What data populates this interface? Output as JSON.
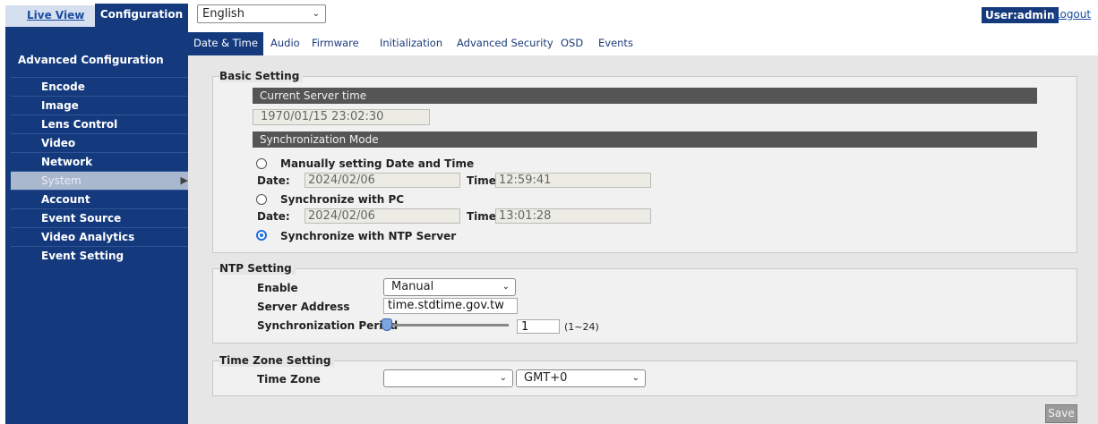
{
  "topbar": {
    "live_view": "Live View",
    "configuration": "Configuration",
    "language": "English",
    "user": "User:admin",
    "separator": "|",
    "logout": "Logout"
  },
  "sidebar": {
    "title": "Advanced Configuration",
    "items": [
      {
        "label": "Encode"
      },
      {
        "label": "Image"
      },
      {
        "label": "Lens Control"
      },
      {
        "label": "Video"
      },
      {
        "label": "Network"
      },
      {
        "label": "System"
      },
      {
        "label": "Account"
      },
      {
        "label": "Event Source"
      },
      {
        "label": "Video Analytics"
      },
      {
        "label": "Event Setting"
      }
    ],
    "active_item": "System"
  },
  "tabs": [
    "Date & Time",
    "Audio",
    "Firmware",
    "Initialization",
    "Advanced Security",
    "OSD",
    "Events"
  ],
  "active_tab": "Date & Time",
  "basic": {
    "legend": "Basic Setting",
    "current_server_time_header": "Current Server time",
    "current_server_time": "1970/01/15 23:02:30",
    "sync_mode_header": "Synchronization Mode",
    "manual": {
      "label": "Manually setting Date and Time",
      "date_label": "Date:",
      "date": "2024/02/06",
      "time_label": "Time:",
      "time": "12:59:41"
    },
    "pc": {
      "label": "Synchronize with PC",
      "date_label": "Date:",
      "date": "2024/02/06",
      "time_label": "Time:",
      "time": "13:01:28"
    },
    "ntp_radio": "Synchronize with NTP Server",
    "selected_mode": "ntp"
  },
  "ntp": {
    "legend": "NTP Setting",
    "enable_label": "Enable",
    "enable_value": "Manual",
    "server_label": "Server Address",
    "server_value": "time.stdtime.gov.tw",
    "period_label": "Synchronization Period",
    "period_value": "1",
    "period_range": "(1~24)"
  },
  "timezone": {
    "legend": "Time Zone Setting",
    "label": "Time Zone",
    "region_value": "",
    "offset_value": "GMT+0"
  },
  "save_label": "Save",
  "colors": {
    "brand_navy": "#143a7d",
    "selected_radio": "#1e6fd9",
    "section_bar": "#555555"
  }
}
